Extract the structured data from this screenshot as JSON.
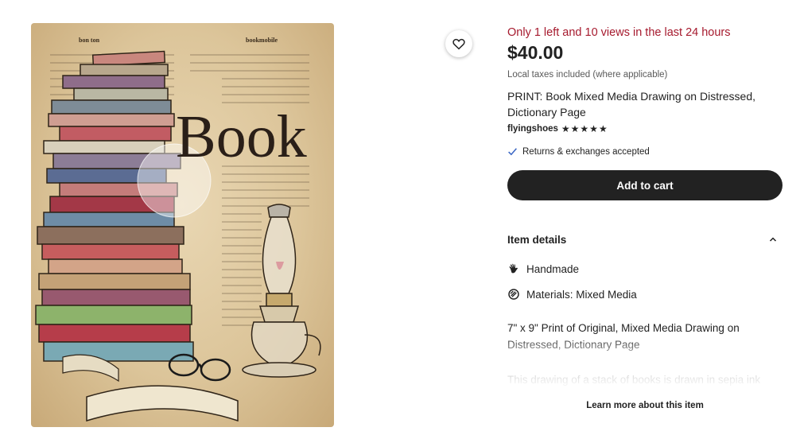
{
  "listing": {
    "image_alt": "Stack of books and oil lamp drawn on a dictionary page",
    "image_headwords": [
      "bon ton",
      "bookmobile"
    ],
    "image_word": "Book",
    "scarcity": "Only 1 left and 10 views in the last 24 hours",
    "price": "$40.00",
    "tax_note": "Local taxes included (where applicable)",
    "title": "PRINT: Book Mixed Media Drawing on Distressed, Dictionary Page",
    "shop_name": "flyingshoes",
    "rating": 5,
    "rating_stars": "★★★★★",
    "returns": "Returns & exchanges accepted",
    "add_to_cart": "Add to cart"
  },
  "item_details": {
    "heading": "Item details",
    "rows": [
      {
        "icon": "hand-icon",
        "label": "Handmade"
      },
      {
        "icon": "materials-icon",
        "label": "Materials: Mixed Media"
      }
    ],
    "desc_line_1": "7\" x 9\" Print of Original, Mixed Media Drawing on Distressed, Dictionary Page",
    "desc_line_2": "This drawing of a stack of books is drawn in sepia ink",
    "learn_more": "Learn more about this item"
  },
  "colors": {
    "scarcity": "#a61a2e",
    "button_bg": "#222222",
    "button_text": "#ffffff"
  },
  "icons": {
    "favorite": "heart-icon",
    "returns": "check-icon",
    "collapse": "chevron-up-icon"
  }
}
